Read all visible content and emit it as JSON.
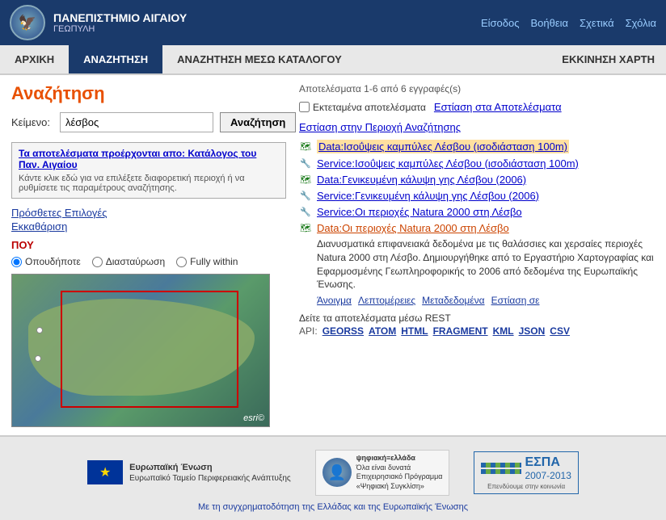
{
  "topbar": {
    "uni_main": "ΠΑΝΕΠΙΣΤΗΜΙΟ ΑΙΓΑΙΟΥ",
    "uni_sub": "ΓΕΩΠΥΛΗ",
    "links": {
      "login": "Είσοδος",
      "help": "Βοήθεια",
      "about": "Σχετικά",
      "school": "Σχόλια"
    }
  },
  "nav": {
    "home": "ΑΡΧΙΚΗ",
    "search": "ΑΝΑΖΗΤΗΣΗ",
    "catalog_search": "ΑΝΑΖΗΤΗΣΗ ΜΕΣΩ ΚΑΤΑΛΟΓΟΥ",
    "map": "ΕΚΚΙΝΗΣΗ ΧΑΡΤΗ"
  },
  "left": {
    "title": "Αναζήτηση",
    "search_label": "Κείμενο:",
    "search_value": "λέσβος",
    "search_btn": "Αναζήτηση",
    "source_title": "Τα αποτελέσματα προέρχονται απο: Κατάλογος του Παν. Αιγαίου",
    "source_detail": "Κάντε κλικ εδώ για να επιλέξετε διαφορετική περιοχή ή να ρυθμίσετε τις παραμέτρους αναζήτησης.",
    "extra_options": "Πρόσθετες Επιλογές",
    "clear": "Εκκαθάριση",
    "where_label": "ΠΟΥ",
    "radio_options": [
      "Οπουδήποτε",
      "Διασταύρωση",
      "Fully within"
    ],
    "map_watermark": "esri©"
  },
  "right": {
    "results_count": "Αποτελέσματα 1-6 από 6 εγγραφές(s)",
    "expanded_label": "Εκτεταμένα αποτελέσματα",
    "focus_results": "Εστίαση στα Αποτελέσματα",
    "focus_area": "Εστίαση στην Περιοχή Αναζήτησης",
    "results": [
      {
        "type": "data",
        "label": "Data:Ισοΰψεις καμπύλες Λέσβου (ισοδιάσταση 100m)",
        "highlight": true
      },
      {
        "type": "service",
        "label": "Service:Ισοΰψεις καμπύλες Λέσβου (ισοδιάσταση 100m)",
        "highlight": false
      },
      {
        "type": "data",
        "label": "Data:Γενικευμένη κάλυψη γης Λέσβου (2006)",
        "highlight": false
      },
      {
        "type": "service",
        "label": "Service:Γενικευμένη κάλυψη γης Λέσβου (2006)",
        "highlight": false
      },
      {
        "type": "service",
        "label": "Service:Οι περιοχές Natura 2000 στη Λέσβο",
        "highlight": false
      },
      {
        "type": "data",
        "label": "Data:Οι περιοχές Natura 2000 στη Λέσβο",
        "highlight": false,
        "description": "Διανυσματικά επιφανειακά δεδομένα με τις θαλάσσιες και χερσαίες περιοχές Natura 2000 στη Λέσβο. Δημιουργήθηκε από το Εργαστήριο Χαρτογραφίας και Εφαρμοσμένης Γεωπληροφορικής το 2006 από δεδομένα της Ευρωπαϊκής Ένωσης.",
        "actions": [
          "Άνοιγμα",
          "Λεπτομέρειες",
          "Μεταδεδομένα",
          "Εστίαση σε"
        ]
      }
    ],
    "rest_label": "Δείτε τα αποτελέσματα μέσω REST",
    "api_label": "API:",
    "api_links": [
      "GEORSS",
      "ATOM",
      "HTML",
      "FRAGMENT",
      "KML",
      "JSON",
      "CSV"
    ]
  },
  "footer": {
    "eu_title": "Ευρωπαϊκή Ένωση",
    "eu_fund": "Ευρωπαϊκό Ταμείο Περιφερειακής Ανάπτυξης",
    "digital_title": "ψηφιακή≡ελλάδα",
    "digital_sub1": "Όλα είναι δυνατά",
    "digital_sub2": "Επιχειρησιακό Πρόγραμμα",
    "digital_sub3": "«Ψηφιακή Συγκλίση»",
    "espa_title": "ΕΣΠΑ",
    "espa_years": "2007-2013",
    "espa_sub": "Με τη συγχρηματοδότηση της Ελλάδας και της Ευρωπαϊκής Ένωσης",
    "footer_bottom": "Με τη συγχρηματοδότηση της Ελλάδας και της Ευρωπαϊκής Ένωσης"
  }
}
